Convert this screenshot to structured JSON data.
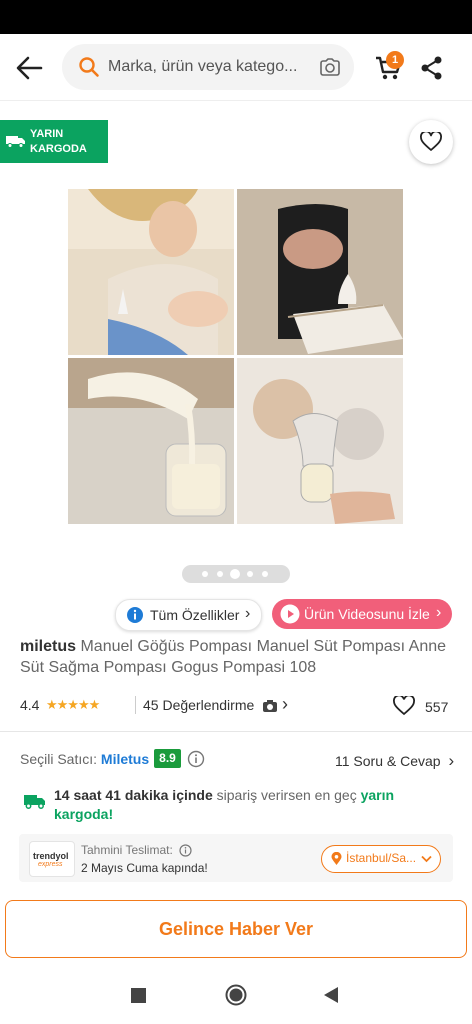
{
  "search": {
    "placeholder": "Marka, ürün veya katego..."
  },
  "cart": {
    "badge_count": "1"
  },
  "cargo_badge": {
    "line1": "YARIN",
    "line2": "KARGODA"
  },
  "gallery": {
    "slides": 5,
    "active_slide": 3
  },
  "buttons": {
    "all_specs": "Tüm Özellikler",
    "product_video": "Ürün Videosunu İzle"
  },
  "product": {
    "brand": "miletus",
    "name": "Manuel Göğüs Pompası Manuel Süt Pompası Anne Süt Sağma Pompası Gogus Pompasi 108",
    "rating": "4.4",
    "stars": "★★★★★",
    "reviews": "45 Değerlendirme",
    "favorites": "557"
  },
  "seller": {
    "label": "Seçili Satıcı:",
    "name": "Miletus",
    "score": "8.9",
    "qa": "11 Soru & Cevap"
  },
  "shipping": {
    "time_bold": "14 saat 41 dakika içinde",
    "middle": "sipariş verirsen en geç",
    "highlight": "yarın kargoda!"
  },
  "delivery": {
    "logo_line1": "trendyol",
    "logo_line2": "express",
    "label": "Tahmini Teslimat:",
    "date": "2 Mayıs Cuma kapında!",
    "location": "İstanbul/Sa..."
  },
  "cta": {
    "label": "Gelince Haber Ver"
  },
  "colors": {
    "brand_orange": "#f27a1a",
    "green": "#0ba360",
    "video_pink": "#f15f7a",
    "link_blue": "#1e7bd6"
  }
}
